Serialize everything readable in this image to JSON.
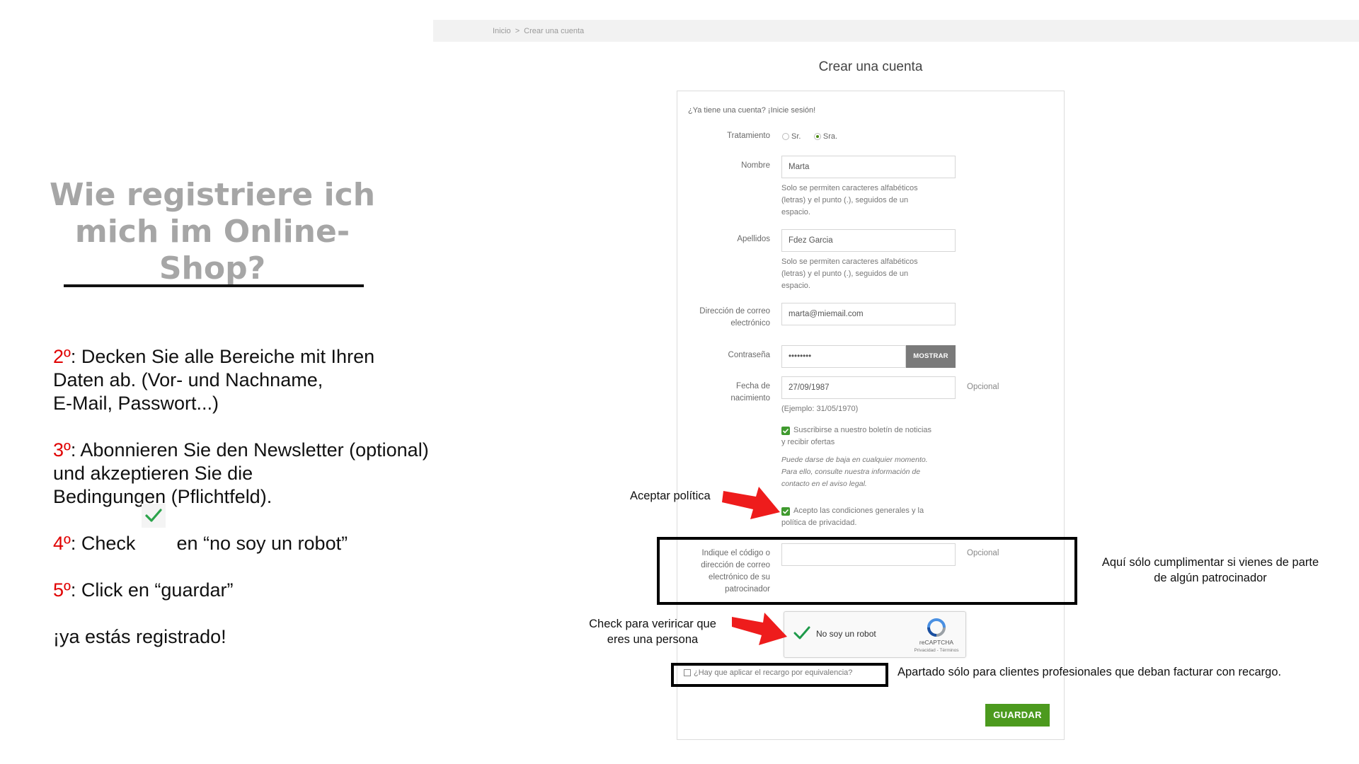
{
  "left": {
    "title_line1": "Wie registriere ich",
    "title_line2": "mich im Online-Shop?",
    "steps": [
      {
        "num": "2º",
        "line1": ": Decken Sie alle Bereiche mit Ihren",
        "line2": "Daten ab. (Vor- und Nachname,",
        "line3": "E-Mail, Passwort...)"
      },
      {
        "num": "3º",
        "line1": ": Abonnieren Sie den Newsletter (optional)",
        "line2": "und akzeptieren Sie die",
        "line3": "Bedingungen (Pflichtfeld)."
      },
      {
        "num": "4º",
        "line1_a": ": Check",
        "line1_b": "en “no soy un robot”"
      },
      {
        "num": "5º",
        "line1": ": Click en “guardar”"
      }
    ],
    "final": "¡ya estás registrado!"
  },
  "breadcrumb": {
    "home": "Inicio",
    "separator": ">",
    "current": "Crear una cuenta"
  },
  "form": {
    "title": "Crear una cuenta",
    "login_prompt": "¿Ya tiene una cuenta? ¡Inicie sesión!",
    "treatment": {
      "label": "Tratamiento",
      "option_mr": "Sr.",
      "option_mrs": "Sra.",
      "selected": "Sra."
    },
    "first_name": {
      "label": "Nombre",
      "value": "Marta",
      "help1": "Solo se permiten caracteres alfabéticos",
      "help2": "(letras) y el punto (.), seguidos de un",
      "help3": "espacio."
    },
    "last_name": {
      "label": "Apellidos",
      "value": "Fdez Garcia",
      "help1": "Solo se permiten caracteres alfabéticos",
      "help2": "(letras) y el punto (.), seguidos de un",
      "help3": "espacio."
    },
    "email": {
      "label1": "Dirección de correo",
      "label2": "electrónico",
      "value": "marta@miemail.com"
    },
    "password": {
      "label": "Contraseña",
      "value": "••••••••",
      "show_button": "MOSTRAR"
    },
    "birthdate": {
      "label1": "Fecha de",
      "label2": "nacimiento",
      "value": "27/09/1987",
      "optional": "Opcional",
      "example": "(Ejemplo: 31/05/1970)"
    },
    "newsletter": {
      "line1": "Suscribirse a nuestro boletín de noticias",
      "line2": "y recibir ofertas",
      "note1": "Puede darse de baja en cualquier momento.",
      "note2": "Para ello, consulte nuestra información de",
      "note3": "contacto en el aviso legal.",
      "checked": true
    },
    "terms": {
      "line1": "Acepto las condiciones generales y la",
      "line2": "política de privacidad.",
      "checked": true
    },
    "sponsor": {
      "label1": "Indique el código o",
      "label2": "dirección de correo",
      "label3": "electrónico de su",
      "label4": "patrocinador",
      "value": "",
      "optional": "Opcional"
    },
    "recaptcha": {
      "text": "No soy un robot",
      "brand": "reCAPTCHA",
      "links": "Privacidad - Términos"
    },
    "equivalence": {
      "text": "¿Hay que aplicar el recargo por equivalencia?",
      "checked": false
    },
    "save_button": "GUARDAR"
  },
  "annotations": {
    "accept_policy": "Aceptar política",
    "sponsor_note_line1": "Aquí sólo cumplimentar si vienes de parte",
    "sponsor_note_line2": "de algún patrocinador",
    "captcha_note_line1": "Check para veriricar que",
    "captcha_note_line2": "eres una persona",
    "equivalence_note": "Apartado sólo para clientes profesionales que deban facturar con recargo."
  },
  "colors": {
    "accent_green": "#4c9a1e",
    "step_red": "#e00000",
    "arrow_red": "#ee1c1c",
    "title_gray": "#a6a6a6"
  }
}
